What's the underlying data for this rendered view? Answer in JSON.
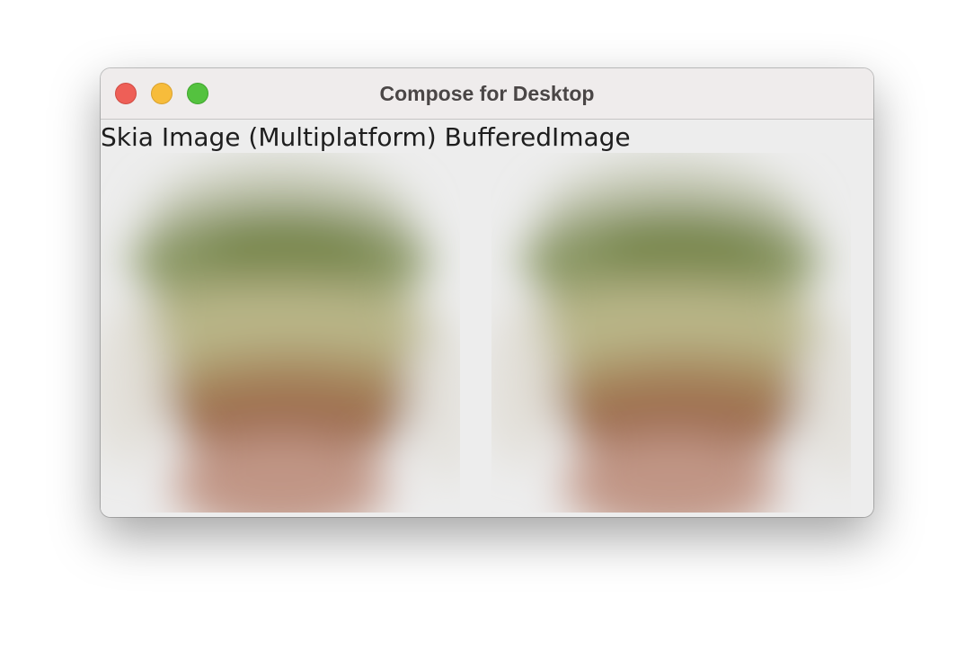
{
  "window": {
    "title": "Compose for Desktop"
  },
  "labels": {
    "skia": "Skia Image (Multiplatform)",
    "buffered": "BufferedImage"
  },
  "images": [
    {
      "name": "skia-image",
      "description_colors": [
        "#7d8a55",
        "#b7b585",
        "#9c6b4c",
        "#c29a8b"
      ]
    },
    {
      "name": "buffered-image",
      "description_colors": [
        "#7d8a55",
        "#b7b585",
        "#9c6b4c",
        "#c29a8b"
      ]
    }
  ]
}
